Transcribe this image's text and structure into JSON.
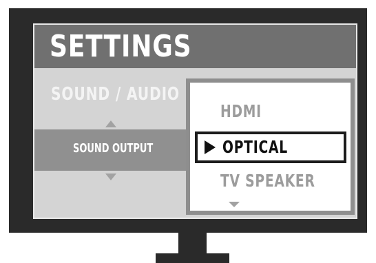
{
  "settings": {
    "title": "SETTINGS"
  },
  "menu": {
    "section_label": "SOUND / AUDIO",
    "selected_setting": "SOUND OUTPUT"
  },
  "options": {
    "items": [
      "HDMI",
      "OPTICAL",
      "TV SPEAKER"
    ],
    "selected": "OPTICAL"
  },
  "colors": {
    "bezel": "#2a2a2a",
    "title_bar": "#707070",
    "menu_bg": "#d4d4d4",
    "highlight_row": "#909090",
    "panel_border": "#8e8e8e"
  }
}
